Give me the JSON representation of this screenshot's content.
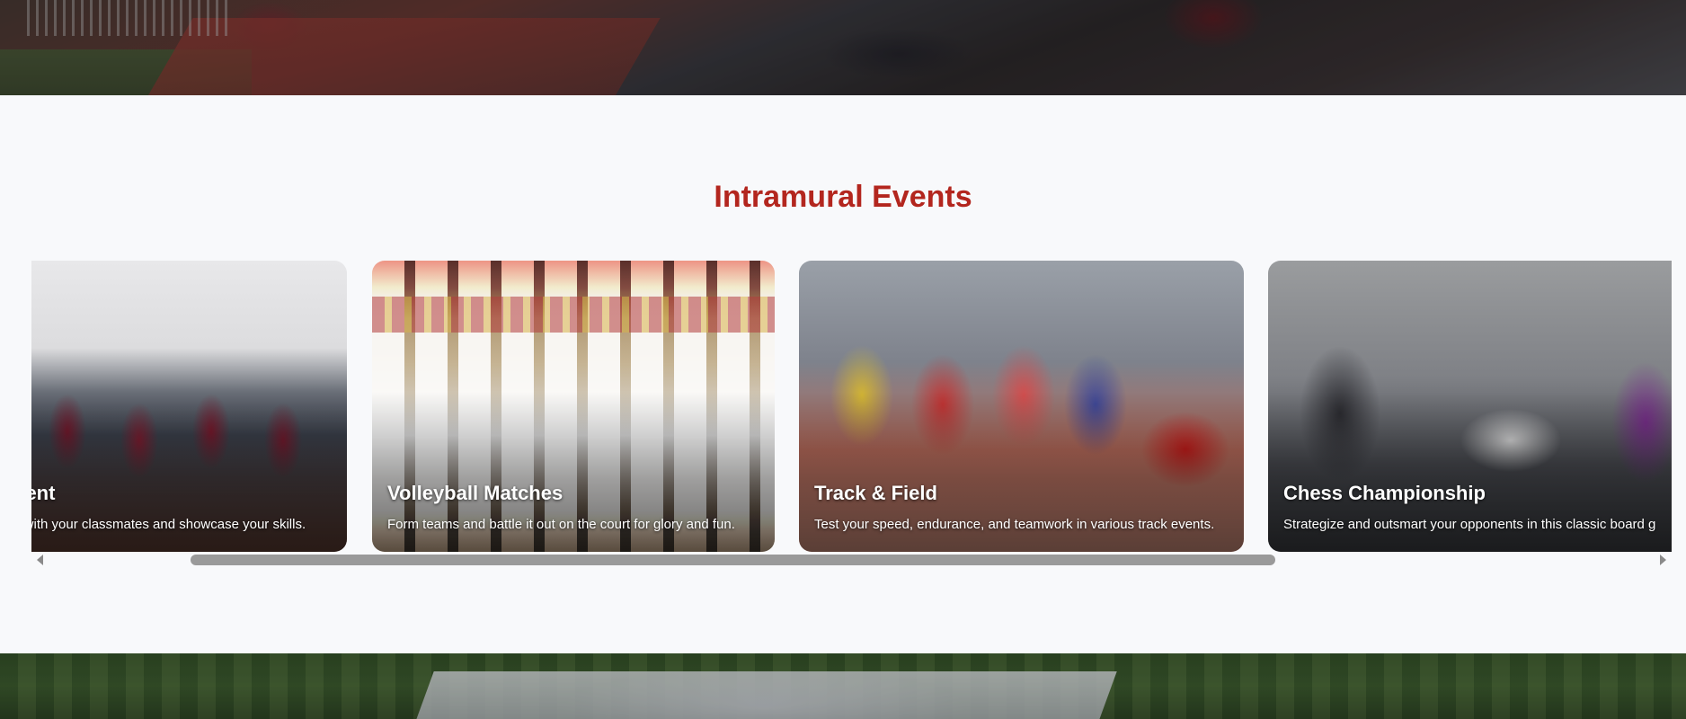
{
  "section": {
    "title": "Intramural Events"
  },
  "events": [
    {
      "title": "nent",
      "description": "s with your classmates and showcase your skills."
    },
    {
      "title": "Volleyball Matches",
      "description": "Form teams and battle it out on the court for glory and fun."
    },
    {
      "title": "Track & Field",
      "description": "Test your speed, endurance, and teamwork in various track events."
    },
    {
      "title": "Chess Championship",
      "description": "Strategize and outsmart your opponents in this classic board g"
    }
  ],
  "colors": {
    "title": "#b3261e",
    "background": "#f8f9fb",
    "scroll_thumb": "#9a9a9a"
  }
}
